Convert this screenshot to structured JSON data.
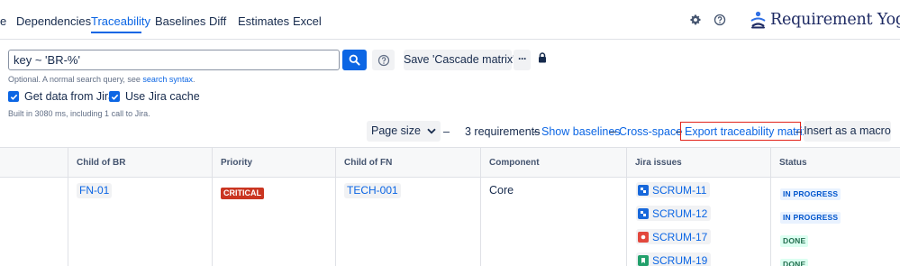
{
  "nav": {
    "partial_tab": "e",
    "tabs": [
      "Dependencies",
      "Traceability",
      "Baselines",
      "Diff",
      "Estimates",
      "Excel"
    ],
    "active_tab": "Traceability",
    "brand": "Requirement Yogi"
  },
  "search": {
    "query": "key ~ 'BR-%'",
    "hint_prefix": "Optional. A normal search query, see ",
    "hint_link": "search syntax",
    "hint_suffix": ".",
    "save_label": "Save 'Cascade matrix'",
    "more_label": "···"
  },
  "options": {
    "get_data_from_jira": "Get data from Jira",
    "use_jira_cache": "Use Jira cache",
    "built_info": "Built in 3080 ms, including 1 call to Jira."
  },
  "toolbar": {
    "page_size_label": "Page size",
    "dash": "–",
    "requirements_count": "3 requirements",
    "show_baselines": "Show baselines",
    "cross_space": "Cross-space",
    "export_matrix": "Export traceability matrix",
    "insert_macro": "Insert as a macro"
  },
  "table": {
    "headers": [
      "Child of BR",
      "Priority",
      "Child of FN",
      "Component",
      "Jira issues",
      "Status"
    ],
    "row": {
      "child_of_br": "FN-01",
      "priority": "CRITICAL",
      "child_of_fn": "TECH-001",
      "component": "Core",
      "jira_issues": [
        {
          "key": "SCRUM-11",
          "type": "task-icon",
          "color": "#1868db",
          "status": "IN PROGRESS",
          "status_kind": "progress"
        },
        {
          "key": "SCRUM-12",
          "type": "task-icon",
          "color": "#1868db",
          "status": "IN PROGRESS",
          "status_kind": "progress"
        },
        {
          "key": "SCRUM-17",
          "type": "bug-icon",
          "color": "#e2483d",
          "status": "DONE",
          "status_kind": "done"
        },
        {
          "key": "SCRUM-19",
          "type": "story-icon",
          "color": "#22a06b",
          "status": "DONE",
          "status_kind": "done"
        }
      ]
    }
  },
  "colors": {
    "accent": "#0c66e4",
    "critical": "#ca3521",
    "highlight_border": "#e2231a"
  }
}
